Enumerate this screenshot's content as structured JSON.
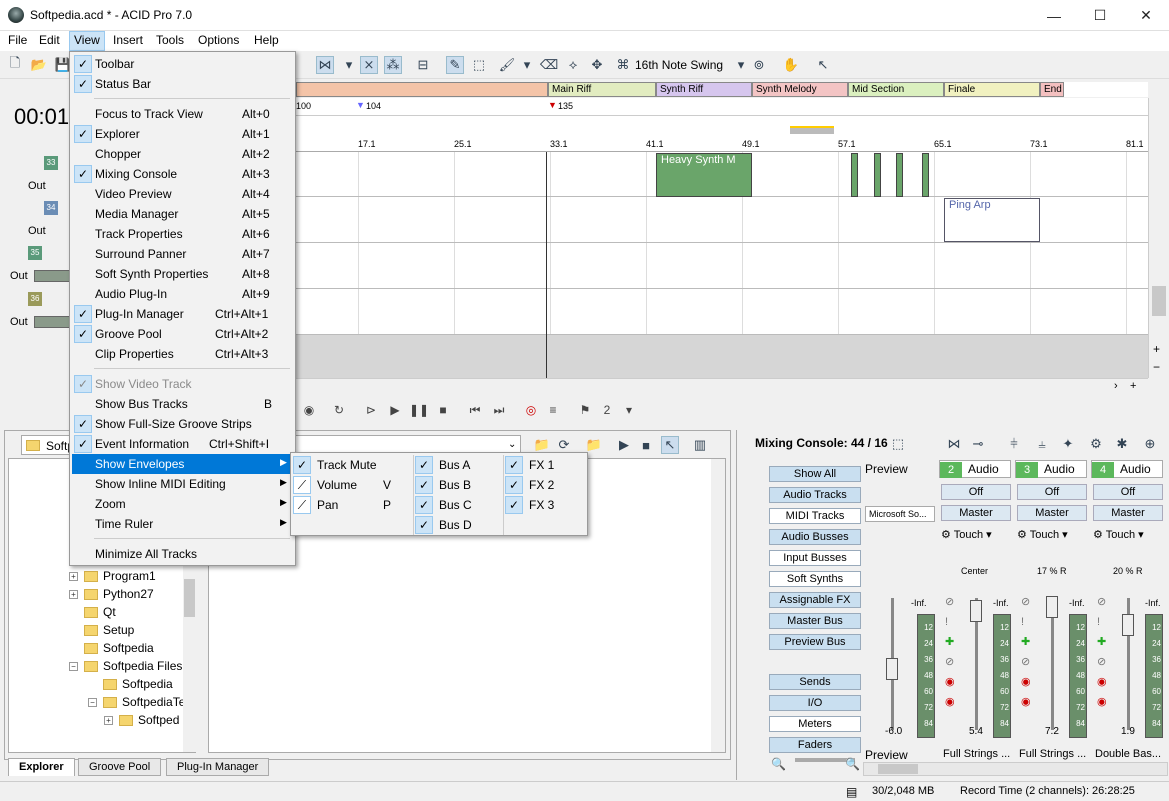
{
  "window": {
    "title": "Softpedia.acd * - ACID Pro 7.0",
    "minimize": "—",
    "maximize": "☐",
    "close": "✕"
  },
  "menubar": [
    "File",
    "Edit",
    "View",
    "Insert",
    "Tools",
    "Options",
    "Help"
  ],
  "toolbar": {
    "swing_label": "16th Note Swing"
  },
  "time_display": "00:01",
  "markers": [
    {
      "label": "Main Riff",
      "color": "#e2ecc0"
    },
    {
      "label": "Synth Riff",
      "color": "#d6c6ee"
    },
    {
      "label": "Synth Melody",
      "color": "#f3c4c4"
    },
    {
      "label": "Mid Section",
      "color": "#dbf0bf"
    },
    {
      "label": "Finale",
      "color": "#f1f1c0"
    },
    {
      "label": "End",
      "color": "#f4c0c0"
    }
  ],
  "tempo_marks": [
    "100",
    "104",
    "135"
  ],
  "ruler_labels": [
    "17.1",
    "25.1",
    "33.1",
    "41.1",
    "49.1",
    "57.1",
    "65.1",
    "73.1",
    "81.1"
  ],
  "tracks": [
    {
      "num": "33",
      "out": "Out"
    },
    {
      "num": "34",
      "out": "Out"
    },
    {
      "num": "35",
      "out": "Out"
    },
    {
      "num": "36",
      "out": "Out"
    }
  ],
  "events": [
    {
      "label": "Heavy Synth M",
      "color": "#6aa56a"
    },
    {
      "label": "Ping Arp",
      "color": "#ffffff"
    }
  ],
  "explorer": {
    "path": "Softp",
    "tree": [
      "Program1",
      "Python27",
      "Qt",
      "Setup",
      "Softpedia",
      "Softpedia Files",
      "Softpedia",
      "SoftpediaTe",
      "Softped"
    ],
    "tabs": [
      "Explorer",
      "Groove Pool",
      "Plug-In Manager"
    ]
  },
  "mixer": {
    "title": "Mixing Console: 44 / 16",
    "preview_label": "Preview",
    "preview_device": "Microsoft So...",
    "preview_fader": "-6.0",
    "buttons": [
      "Show All",
      "Audio Tracks",
      "MIDI Tracks",
      "Audio Busses",
      "Input Busses",
      "Soft Synths",
      "Assignable FX",
      "Master Bus",
      "Preview Bus"
    ],
    "bottom_buttons": [
      "Sends",
      "I/O",
      "Meters",
      "Faders"
    ],
    "strips": [
      {
        "num": "2",
        "name": "Audio",
        "fx": "Off",
        "bus": "Master",
        "mode": "Touch",
        "pan": "Center",
        "value": "5.4",
        "footer": "Full Strings ..."
      },
      {
        "num": "3",
        "name": "Audio",
        "fx": "Off",
        "bus": "Master",
        "mode": "Touch",
        "pan": "17 % R",
        "value": "7.2",
        "footer": "Full Strings ..."
      },
      {
        "num": "4",
        "name": "Audio",
        "fx": "Off",
        "bus": "Master",
        "mode": "Touch",
        "pan": "20 % R",
        "value": "1.9",
        "footer": "Double Bas..."
      }
    ],
    "meter_inf": "-Inf.",
    "meter_scale": [
      "12",
      "24",
      "36",
      "48",
      "60",
      "72",
      "84"
    ]
  },
  "status": {
    "memory": "30/2,048 MB",
    "record_time": "Record Time (2 channels): 26:28:25"
  },
  "view_menu": {
    "items": [
      {
        "label": "Toolbar",
        "checked": true,
        "shortcut": ""
      },
      {
        "label": "Status Bar",
        "checked": true,
        "shortcut": ""
      },
      {
        "label": "Focus to Track View",
        "checked": false,
        "shortcut": "Alt+0"
      },
      {
        "label": "Explorer",
        "checked": true,
        "shortcut": "Alt+1"
      },
      {
        "label": "Chopper",
        "checked": false,
        "shortcut": "Alt+2"
      },
      {
        "label": "Mixing Console",
        "checked": true,
        "shortcut": "Alt+3"
      },
      {
        "label": "Video Preview",
        "checked": false,
        "shortcut": "Alt+4"
      },
      {
        "label": "Media Manager",
        "checked": false,
        "shortcut": "Alt+5"
      },
      {
        "label": "Track Properties",
        "checked": false,
        "shortcut": "Alt+6"
      },
      {
        "label": "Surround Panner",
        "checked": false,
        "shortcut": "Alt+7"
      },
      {
        "label": "Soft Synth Properties",
        "checked": false,
        "shortcut": "Alt+8"
      },
      {
        "label": "Audio Plug-In",
        "checked": false,
        "shortcut": "Alt+9"
      },
      {
        "label": "Plug-In Manager",
        "checked": true,
        "shortcut": "Ctrl+Alt+1"
      },
      {
        "label": "Groove Pool",
        "checked": true,
        "shortcut": "Ctrl+Alt+2"
      },
      {
        "label": "Clip Properties",
        "checked": false,
        "shortcut": "Ctrl+Alt+3"
      },
      {
        "label": "Show Video Track",
        "checked": true,
        "shortcut": "",
        "disabled": true
      },
      {
        "label": "Show Bus Tracks",
        "checked": false,
        "shortcut": "B"
      },
      {
        "label": "Show Full-Size Groove Strips",
        "checked": true,
        "shortcut": ""
      },
      {
        "label": "Event Information",
        "checked": true,
        "shortcut": "Ctrl+Shift+I"
      },
      {
        "label": "Show Envelopes",
        "checked": false,
        "shortcut": "",
        "submenu": true,
        "highlighted": true
      },
      {
        "label": "Show Inline MIDI Editing",
        "checked": false,
        "shortcut": "",
        "submenu": true
      },
      {
        "label": "Zoom",
        "checked": false,
        "shortcut": "",
        "submenu": true
      },
      {
        "label": "Time Ruler",
        "checked": false,
        "shortcut": "",
        "submenu": true
      },
      {
        "label": "Minimize All Tracks",
        "checked": false,
        "shortcut": ""
      }
    ]
  },
  "envelopes_submenu": {
    "col1": [
      {
        "label": "Track Mute",
        "checked": true,
        "shortcut": ""
      },
      {
        "label": "Volume",
        "checked": false,
        "shortcut": "V"
      },
      {
        "label": "Pan",
        "checked": false,
        "shortcut": "P"
      }
    ],
    "col2": [
      "Bus A",
      "Bus B",
      "Bus C",
      "Bus D"
    ],
    "col3": [
      "FX 1",
      "FX 2",
      "FX 3"
    ]
  }
}
